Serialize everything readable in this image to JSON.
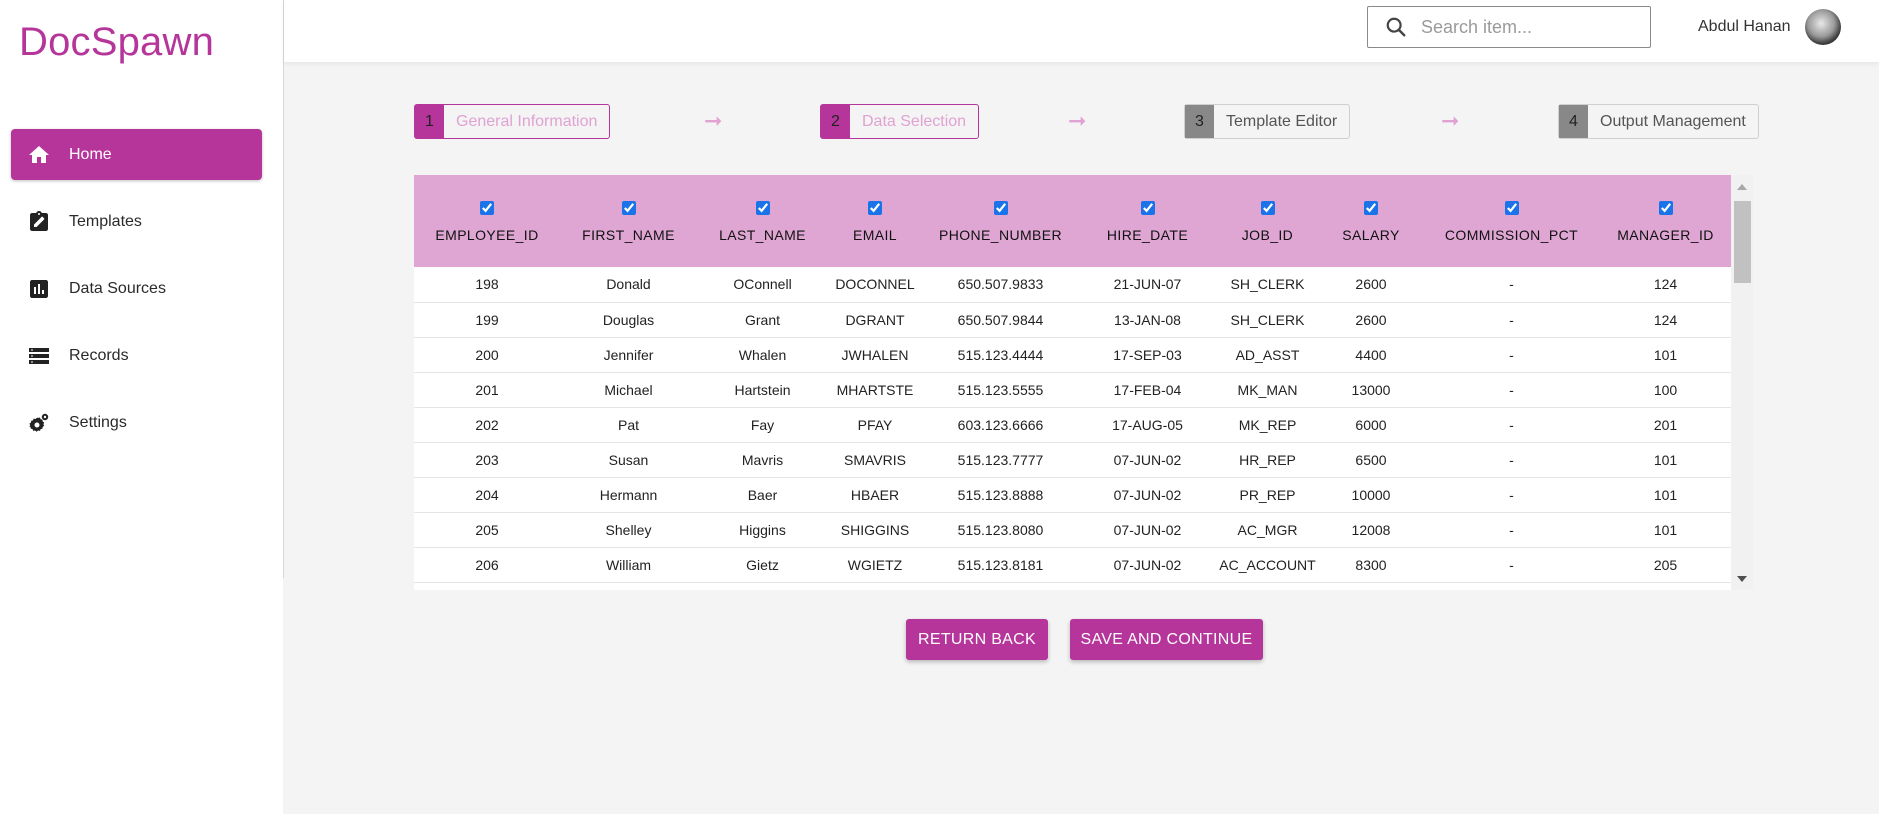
{
  "app": {
    "logo": "DocSpawn"
  },
  "sidebar": {
    "items": [
      {
        "label": "Home",
        "icon": "home-icon",
        "active": true
      },
      {
        "label": "Templates",
        "icon": "clipboard-edit-icon",
        "active": false
      },
      {
        "label": "Data Sources",
        "icon": "bar-chart-icon",
        "active": false
      },
      {
        "label": "Records",
        "icon": "list-icon",
        "active": false
      },
      {
        "label": "Settings",
        "icon": "gears-icon",
        "active": false
      }
    ]
  },
  "header": {
    "search_placeholder": "Search item...",
    "user_name": "Abdul Hanan"
  },
  "stepper": {
    "steps": [
      {
        "num": "1",
        "label": "General Information",
        "state": "done"
      },
      {
        "num": "2",
        "label": "Data Selection",
        "state": "active"
      },
      {
        "num": "3",
        "label": "Template Editor",
        "state": "inactive"
      },
      {
        "num": "4",
        "label": "Output Management",
        "state": "inactive"
      }
    ],
    "arrow": "➞"
  },
  "table": {
    "columns": [
      "EMPLOYEE_ID",
      "FIRST_NAME",
      "LAST_NAME",
      "EMAIL",
      "PHONE_NUMBER",
      "HIRE_DATE",
      "JOB_ID",
      "SALARY",
      "COMMISSION_PCT",
      "MANAGER_ID"
    ],
    "rows": [
      [
        "198",
        "Donald",
        "OConnell",
        "DOCONNEL",
        "650.507.9833",
        "21-JUN-07",
        "SH_CLERK",
        "2600",
        "-",
        "124"
      ],
      [
        "199",
        "Douglas",
        "Grant",
        "DGRANT",
        "650.507.9844",
        "13-JAN-08",
        "SH_CLERK",
        "2600",
        "-",
        "124"
      ],
      [
        "200",
        "Jennifer",
        "Whalen",
        "JWHALEN",
        "515.123.4444",
        "17-SEP-03",
        "AD_ASST",
        "4400",
        "-",
        "101"
      ],
      [
        "201",
        "Michael",
        "Hartstein",
        "MHARTSTE",
        "515.123.5555",
        "17-FEB-04",
        "MK_MAN",
        "13000",
        "-",
        "100"
      ],
      [
        "202",
        "Pat",
        "Fay",
        "PFAY",
        "603.123.6666",
        "17-AUG-05",
        "MK_REP",
        "6000",
        "-",
        "201"
      ],
      [
        "203",
        "Susan",
        "Mavris",
        "SMAVRIS",
        "515.123.7777",
        "07-JUN-02",
        "HR_REP",
        "6500",
        "-",
        "101"
      ],
      [
        "204",
        "Hermann",
        "Baer",
        "HBAER",
        "515.123.8888",
        "07-JUN-02",
        "PR_REP",
        "10000",
        "-",
        "101"
      ],
      [
        "205",
        "Shelley",
        "Higgins",
        "SHIGGINS",
        "515.123.8080",
        "07-JUN-02",
        "AC_MGR",
        "12008",
        "-",
        "101"
      ],
      [
        "206",
        "William",
        "Gietz",
        "WGIETZ",
        "515.123.8181",
        "07-JUN-02",
        "AC_ACCOUNT",
        "8300",
        "-",
        "205"
      ]
    ]
  },
  "actions": {
    "back_label": "RETURN BACK",
    "save_label": "SAVE AND CONTINUE"
  },
  "colors": {
    "accent": "#b5359b",
    "header_row": "#dfa6d4",
    "step_label_light": "#e0a2d2"
  }
}
